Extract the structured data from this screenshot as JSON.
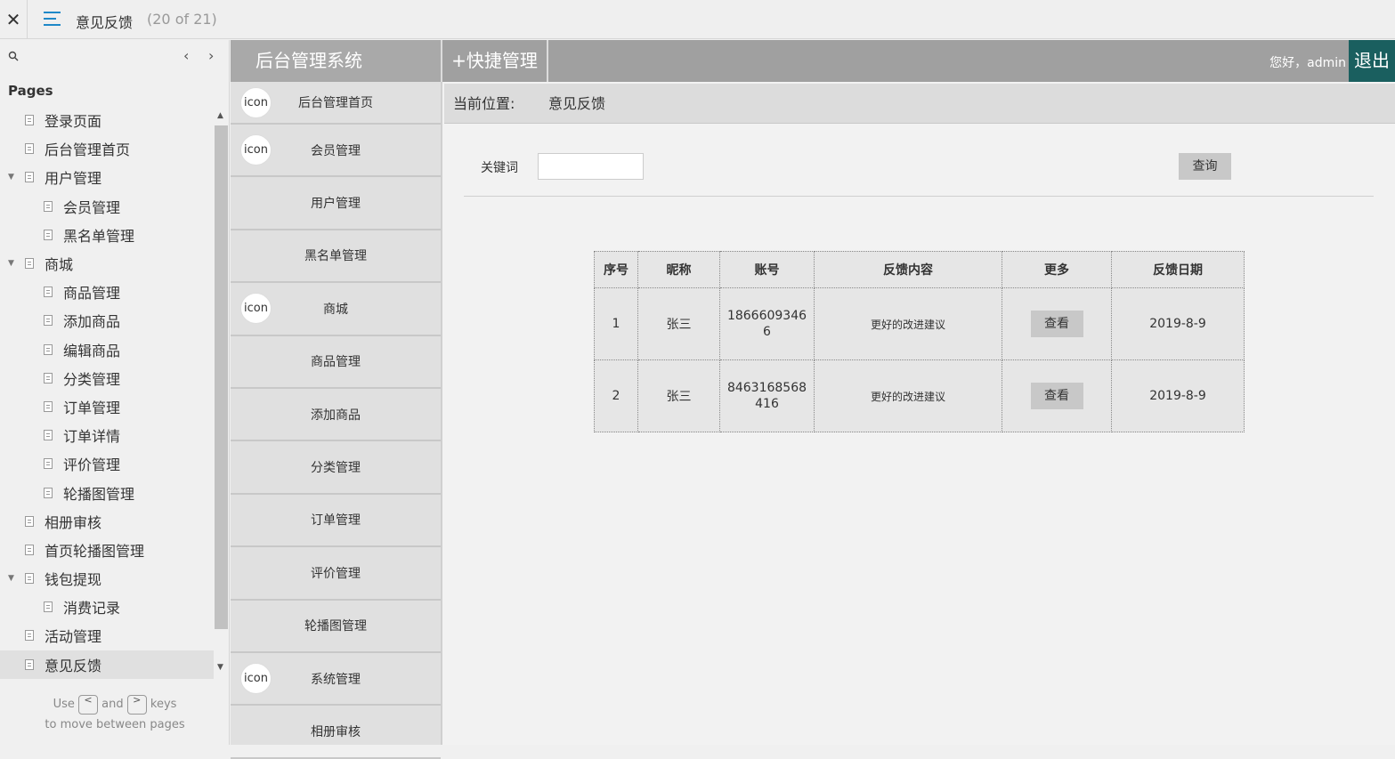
{
  "viewer": {
    "close": "✕",
    "title": "意见反馈",
    "count": "(20 of 21)"
  },
  "pages_panel": {
    "heading": "Pages",
    "items": [
      {
        "label": "登录页面",
        "level": 1,
        "caret": false
      },
      {
        "label": "后台管理首页",
        "level": 1,
        "caret": false
      },
      {
        "label": "用户管理",
        "level": 1,
        "caret": true
      },
      {
        "label": "会员管理",
        "level": 2,
        "caret": false
      },
      {
        "label": "黑名单管理",
        "level": 2,
        "caret": false
      },
      {
        "label": "商城",
        "level": 1,
        "caret": true
      },
      {
        "label": "商品管理",
        "level": 2,
        "caret": false
      },
      {
        "label": "添加商品",
        "level": 2,
        "caret": false
      },
      {
        "label": "编辑商品",
        "level": 2,
        "caret": false
      },
      {
        "label": "分类管理",
        "level": 2,
        "caret": false
      },
      {
        "label": "订单管理",
        "level": 2,
        "caret": false
      },
      {
        "label": "订单详情",
        "level": 2,
        "caret": false
      },
      {
        "label": "评价管理",
        "level": 2,
        "caret": false
      },
      {
        "label": "轮播图管理",
        "level": 2,
        "caret": false
      },
      {
        "label": "相册审核",
        "level": 1,
        "caret": false
      },
      {
        "label": "首页轮播图管理",
        "level": 1,
        "caret": false
      },
      {
        "label": "钱包提现",
        "level": 1,
        "caret": true
      },
      {
        "label": "消费记录",
        "level": 2,
        "caret": false
      },
      {
        "label": "活动管理",
        "level": 1,
        "caret": false
      },
      {
        "label": "意见反馈",
        "level": 1,
        "caret": false,
        "selected": true
      }
    ],
    "hint_use": "Use",
    "hint_prev_key": "<",
    "hint_and": "and",
    "hint_next_key": ">",
    "hint_keys": "keys",
    "hint_line2": "to move between pages"
  },
  "header": {
    "system_title": "后台管理系统",
    "quick": "+快捷管理",
    "greeting": "您好，admin",
    "logout": "退出",
    "logout_color": "#1a5f5f"
  },
  "side_menu": {
    "items": [
      {
        "label": "后台管理首页",
        "icon": "icon"
      },
      {
        "label": "会员管理",
        "icon": "icon"
      },
      {
        "label": "用户管理",
        "icon": ""
      },
      {
        "label": "黑名单管理",
        "icon": ""
      },
      {
        "label": "商城",
        "icon": "icon"
      },
      {
        "label": "商品管理",
        "icon": ""
      },
      {
        "label": "添加商品",
        "icon": ""
      },
      {
        "label": "分类管理",
        "icon": ""
      },
      {
        "label": "订单管理",
        "icon": ""
      },
      {
        "label": "评价管理",
        "icon": ""
      },
      {
        "label": "轮播图管理",
        "icon": ""
      },
      {
        "label": "系统管理",
        "icon": "icon"
      },
      {
        "label": "相册审核",
        "icon": ""
      }
    ]
  },
  "breadcrumb": {
    "label": "当前位置:",
    "value": "意见反馈"
  },
  "search": {
    "label": "关键词",
    "value": "",
    "button": "查询"
  },
  "table": {
    "headers": [
      "序号",
      "昵称",
      "账号",
      "反馈内容",
      "更多",
      "反馈日期"
    ],
    "rows": [
      {
        "id": "1",
        "nickname": "张三",
        "account": "18666093466",
        "content": "更好的改进建议",
        "action": "查看",
        "date": "2019-8-9"
      },
      {
        "id": "2",
        "nickname": "张三",
        "account": "8463168568416",
        "content": "更好的改进建议",
        "action": "查看",
        "date": "2019-8-9"
      }
    ]
  }
}
